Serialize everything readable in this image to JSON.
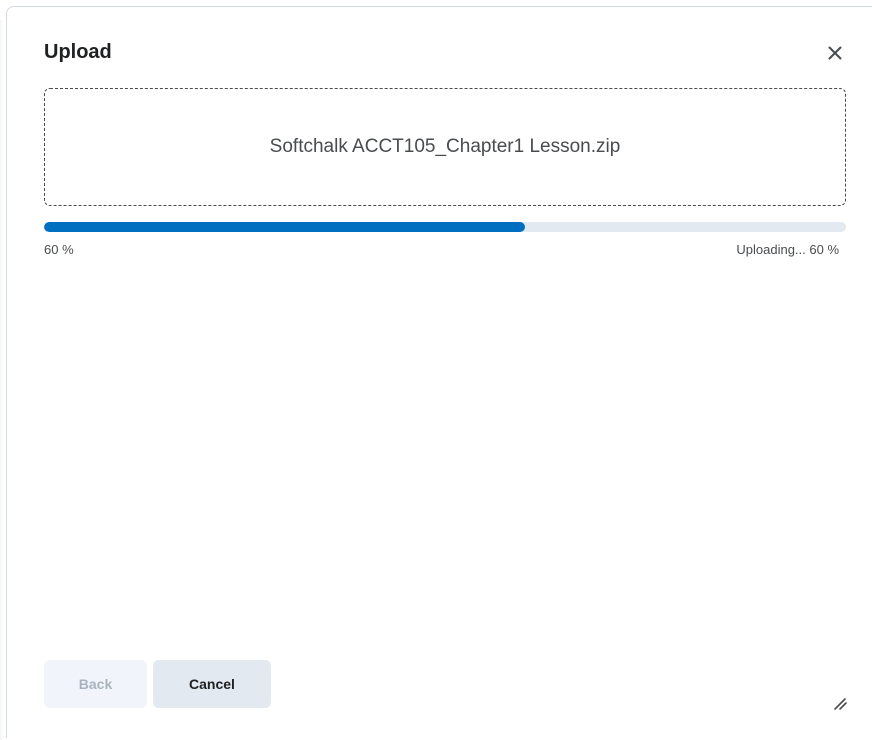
{
  "dialog": {
    "title": "Upload",
    "close_icon": "close-icon"
  },
  "upload": {
    "filename": "Softchalk ACCT105_Chapter1 Lesson.zip",
    "progress_fraction": 0.6,
    "progress_left_label": "60 %",
    "progress_status_label": "Uploading... 60 %"
  },
  "footer": {
    "back_label": "Back",
    "back_disabled": true,
    "cancel_label": "Cancel",
    "resize_icon": "resize-handle-icon"
  },
  "colors": {
    "accent": "#006fbf",
    "track": "#e3e9f1",
    "text": "#202122",
    "muted_text": "#494c4e"
  }
}
